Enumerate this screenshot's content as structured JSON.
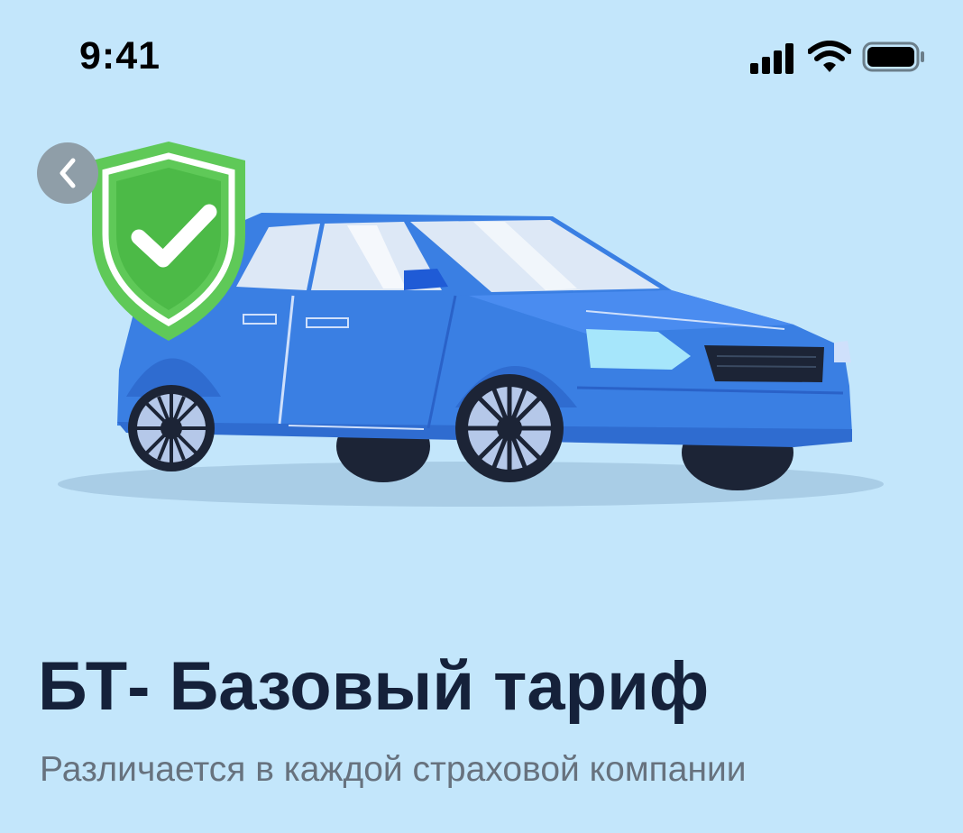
{
  "status_bar": {
    "time": "9:41",
    "icons": [
      "signal-icon",
      "wifi-icon",
      "battery-icon"
    ]
  },
  "navigation": {
    "back_icon": "chevron-left-icon"
  },
  "hero": {
    "illustration": [
      "blue-car-illustration",
      "shield-check-icon"
    ],
    "colors": {
      "car": "#3a7fe3",
      "shield": "#5fc958",
      "background": "#c3e6fb"
    }
  },
  "content": {
    "title": "БТ- Базовый тариф",
    "subtitle": "Различается в каждой страховой компании"
  }
}
